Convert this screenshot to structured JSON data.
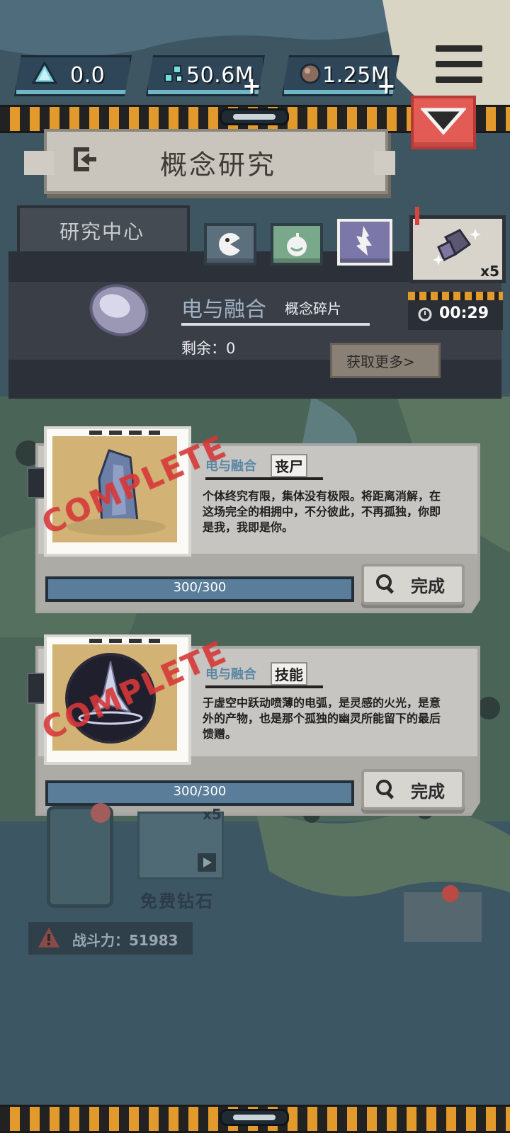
{
  "resources": [
    {
      "icon": "crystal-icon",
      "value": "0.0",
      "has_plus": false
    },
    {
      "icon": "gem-cluster-icon",
      "value": "50.6M",
      "has_plus": true
    },
    {
      "icon": "ore-icon",
      "value": "1.25M",
      "has_plus": true
    }
  ],
  "header": {
    "title": "概念研究",
    "exit_icon": "exit-icon"
  },
  "tabs": {
    "research_center": "研究中心"
  },
  "reward": {
    "count": "x5"
  },
  "timer": {
    "value": "00:29"
  },
  "fragment": {
    "name": "电与融合",
    "type": "概念碎片",
    "remaining": "剩余：0",
    "more_button": "获取更多>"
  },
  "cards": [
    {
      "name": "电与融合",
      "type": "丧尸",
      "description": "个体终究有限，集体没有极限。将距离消解，在这场完全的相拥中，不分彼此，不再孤独，你即是我，我即是你。",
      "progress_label": "300/300",
      "progress_fraction": 1.0,
      "stamp": "COMPLETE",
      "button": "完成"
    },
    {
      "name": "电与融合",
      "type": "技能",
      "description": "于虚空中跃动喷薄的电弧，是灵感的火光，是意外的产物，也是那个孤独的幽灵所能留下的最后馈赠。",
      "progress_label": "300/300",
      "progress_fraction": 1.0,
      "stamp": "COMPLETE",
      "button": "完成"
    }
  ],
  "bottom": {
    "free_diamond": "免费钻石",
    "video_reward": "x5",
    "power": "战斗力：51983"
  },
  "colors": {
    "accent_red": "#e25b55",
    "hazard_orange": "#e39a2c",
    "progress_blue": "#4c6b85"
  }
}
